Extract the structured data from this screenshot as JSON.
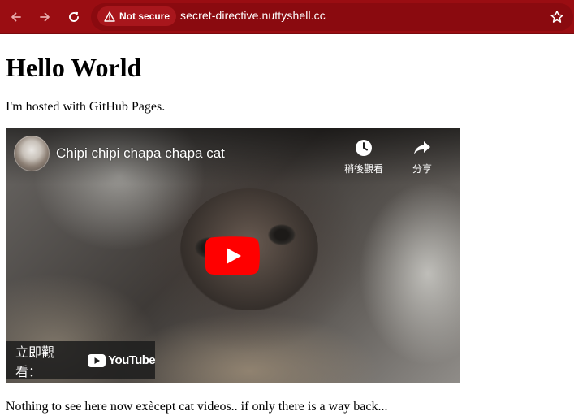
{
  "browser": {
    "security_label": "Not secure",
    "url": "secret-directive.nuttyshell.cc",
    "toolbar_color": "#9a0d12"
  },
  "page": {
    "heading": "Hello World",
    "intro": "I'm hosted with GitHub Pages.",
    "footer": "Nothing to see here now exècept cat videos.. if only there is a way back..."
  },
  "video": {
    "title": "Chipi chipi chapa chapa cat",
    "watch_later_label": "稍後觀看",
    "share_label": "分享",
    "watch_on_label": "立即觀看：",
    "platform_name": "YouTube",
    "play_color": "#ff0000"
  },
  "icons": [
    "back-arrow-icon",
    "forward-arrow-icon",
    "reload-icon",
    "warning-icon",
    "star-icon",
    "clock-icon",
    "share-icon",
    "play-icon",
    "youtube-logo-icon"
  ]
}
